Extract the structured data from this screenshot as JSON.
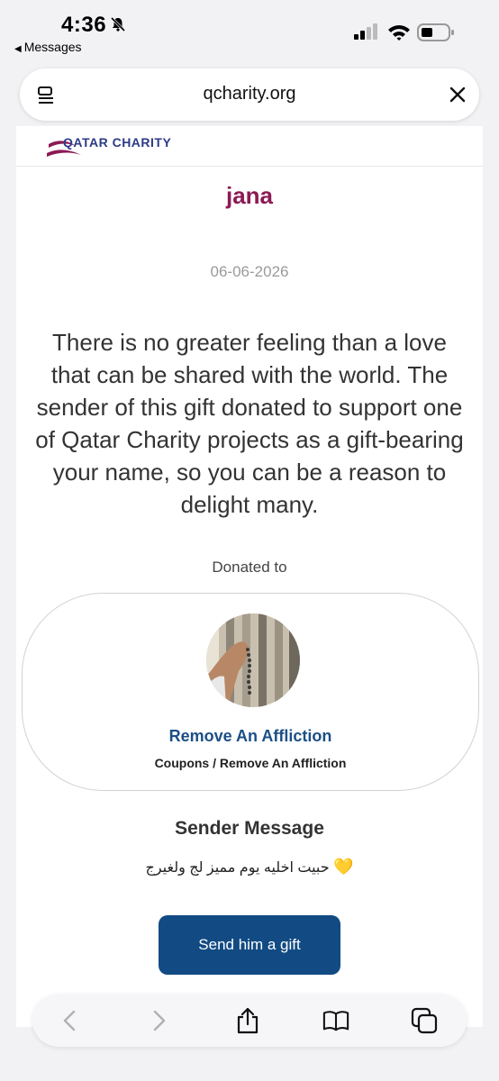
{
  "status_bar": {
    "time": "4:36",
    "back_label": "Messages",
    "bell_icon": "bell-slash-icon",
    "signal_icon": "cellular-signal-icon",
    "wifi_icon": "wifi-icon",
    "battery_icon": "battery-icon"
  },
  "url_bar": {
    "url": "qcharity.org",
    "left_icon": "reader-icon",
    "right_icon": "close-icon"
  },
  "page": {
    "logo_text": "QATAR CHARITY",
    "recipient_name": "jana",
    "date": "06-06-2026",
    "message": "There is no greater feeling than a love that can be shared with the world. The sender of this gift donated to support one of Qatar Charity projects as a gift-bearing your name, so you can be a reason to delight many.",
    "donated_label": "Donated to",
    "project": {
      "title": "Remove An Affliction",
      "path": "Coupons / Remove An Affliction",
      "image_icon": "praying-hands-photo"
    },
    "sender_title": "Sender Message",
    "sender_message": "حبيت اخليه يوم مميز لج ولغيرج",
    "sender_emoji": "💛",
    "gift_button": "Send him a gift"
  },
  "toolbar": {
    "icons": [
      "back-icon",
      "forward-icon",
      "share-icon",
      "bookmarks-icon",
      "tabs-icon"
    ]
  },
  "colors": {
    "name": "#8b1a55",
    "project_title": "#1c4f86",
    "button": "#124b83"
  }
}
